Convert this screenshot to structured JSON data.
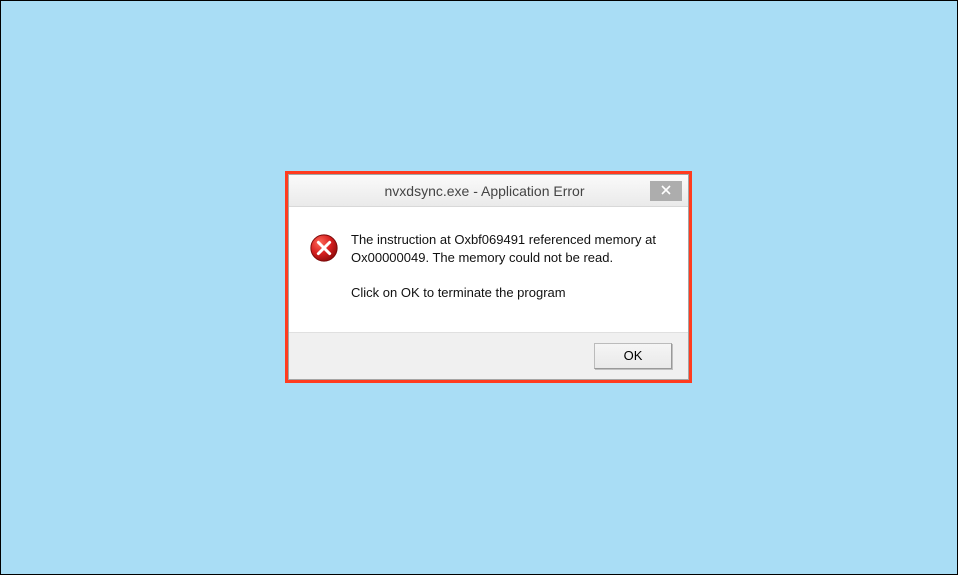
{
  "dialog": {
    "title": "nvxdsync.exe - Application Error",
    "message_line1": "The instruction at Oxbf069491 referenced memory at Ox00000049. The memory could not be read.",
    "message_line2": "Click on OK to terminate the program",
    "ok_label": "OK"
  }
}
